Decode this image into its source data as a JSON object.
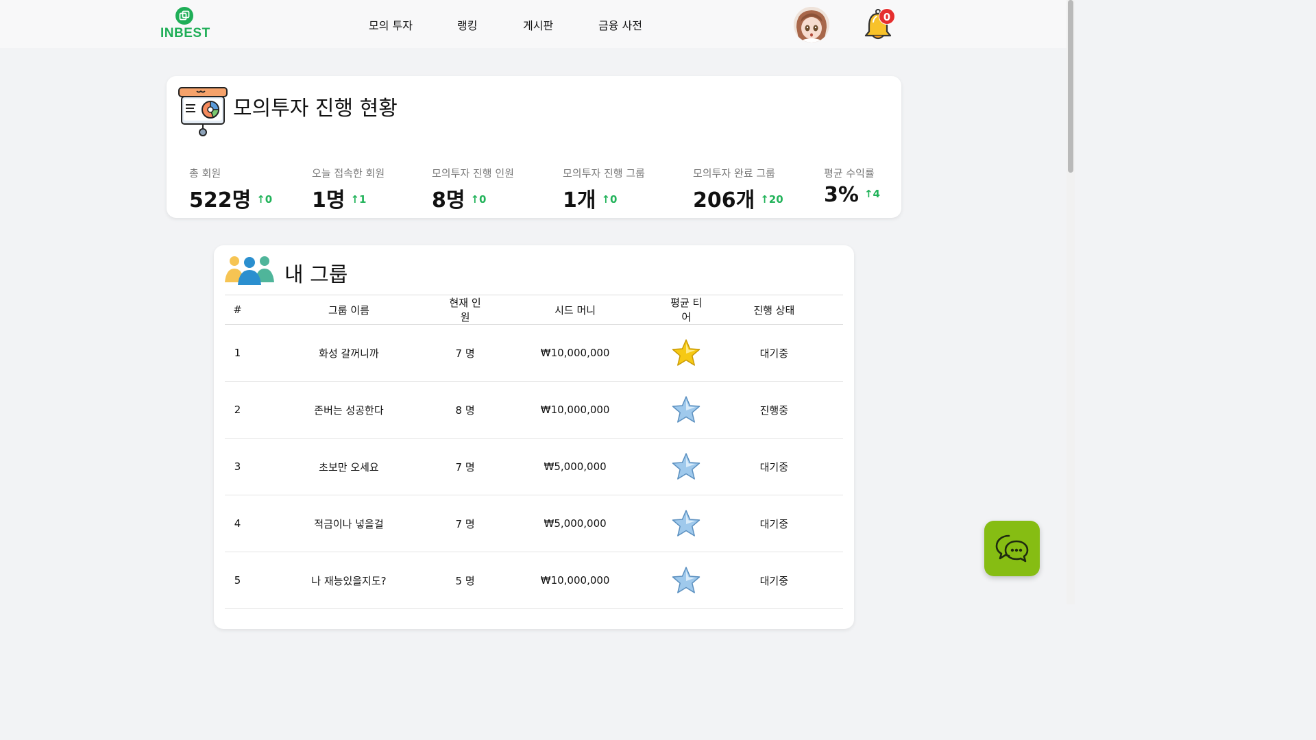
{
  "brand": {
    "name": "INBEST",
    "color": "#1fae57"
  },
  "nav": [
    {
      "label": "모의 투자"
    },
    {
      "label": "랭킹"
    },
    {
      "label": "게시판"
    },
    {
      "label": "금융 사전"
    }
  ],
  "notifications": {
    "count": "0"
  },
  "stats": {
    "title": "모의투자 진행 현황",
    "items": [
      {
        "label": "총 회원",
        "value": "522명",
        "delta": "↑0"
      },
      {
        "label": "오늘 접속한 회원",
        "value": "1명",
        "delta": "↑1"
      },
      {
        "label": "모의투자 진행 인원",
        "value": "8명",
        "delta": "↑0"
      },
      {
        "label": "모의투자 진행 그룹",
        "value": "1개",
        "delta": "↑0"
      },
      {
        "label": "모의투자 완료 그룹",
        "value": "206개",
        "delta": "↑20"
      },
      {
        "label": "평균 수익률",
        "value": "3%",
        "delta": "↑4"
      }
    ]
  },
  "groups": {
    "title": "내 그룹",
    "columns": [
      "#",
      "그룹 이름",
      "현재 인원",
      "시드 머니",
      "평균 티어",
      "진행 상태"
    ],
    "rows": [
      {
        "num": "1",
        "name": "화성 갈꺼니까",
        "members": "7 명",
        "seed": "₩10,000,000",
        "tier": "gold-star-icon",
        "status": "대기중"
      },
      {
        "num": "2",
        "name": "존버는 성공한다",
        "members": "8 명",
        "seed": "₩10,000,000",
        "tier": "blue-star-icon",
        "status": "진행중"
      },
      {
        "num": "3",
        "name": "초보만 오세요",
        "members": "7 명",
        "seed": "₩5,000,000",
        "tier": "blue-star-icon",
        "status": "대기중"
      },
      {
        "num": "4",
        "name": "적금이나 넣을걸",
        "members": "7 명",
        "seed": "₩5,000,000",
        "tier": "blue-star-icon",
        "status": "대기중"
      },
      {
        "num": "5",
        "name": "나 재능있을지도?",
        "members": "5 명",
        "seed": "₩10,000,000",
        "tier": "blue-star-icon",
        "status": "대기중"
      }
    ]
  },
  "colors": {
    "accent_up": "#22b35a",
    "chat_button": "#86bd13",
    "badge": "#e52e2e"
  }
}
